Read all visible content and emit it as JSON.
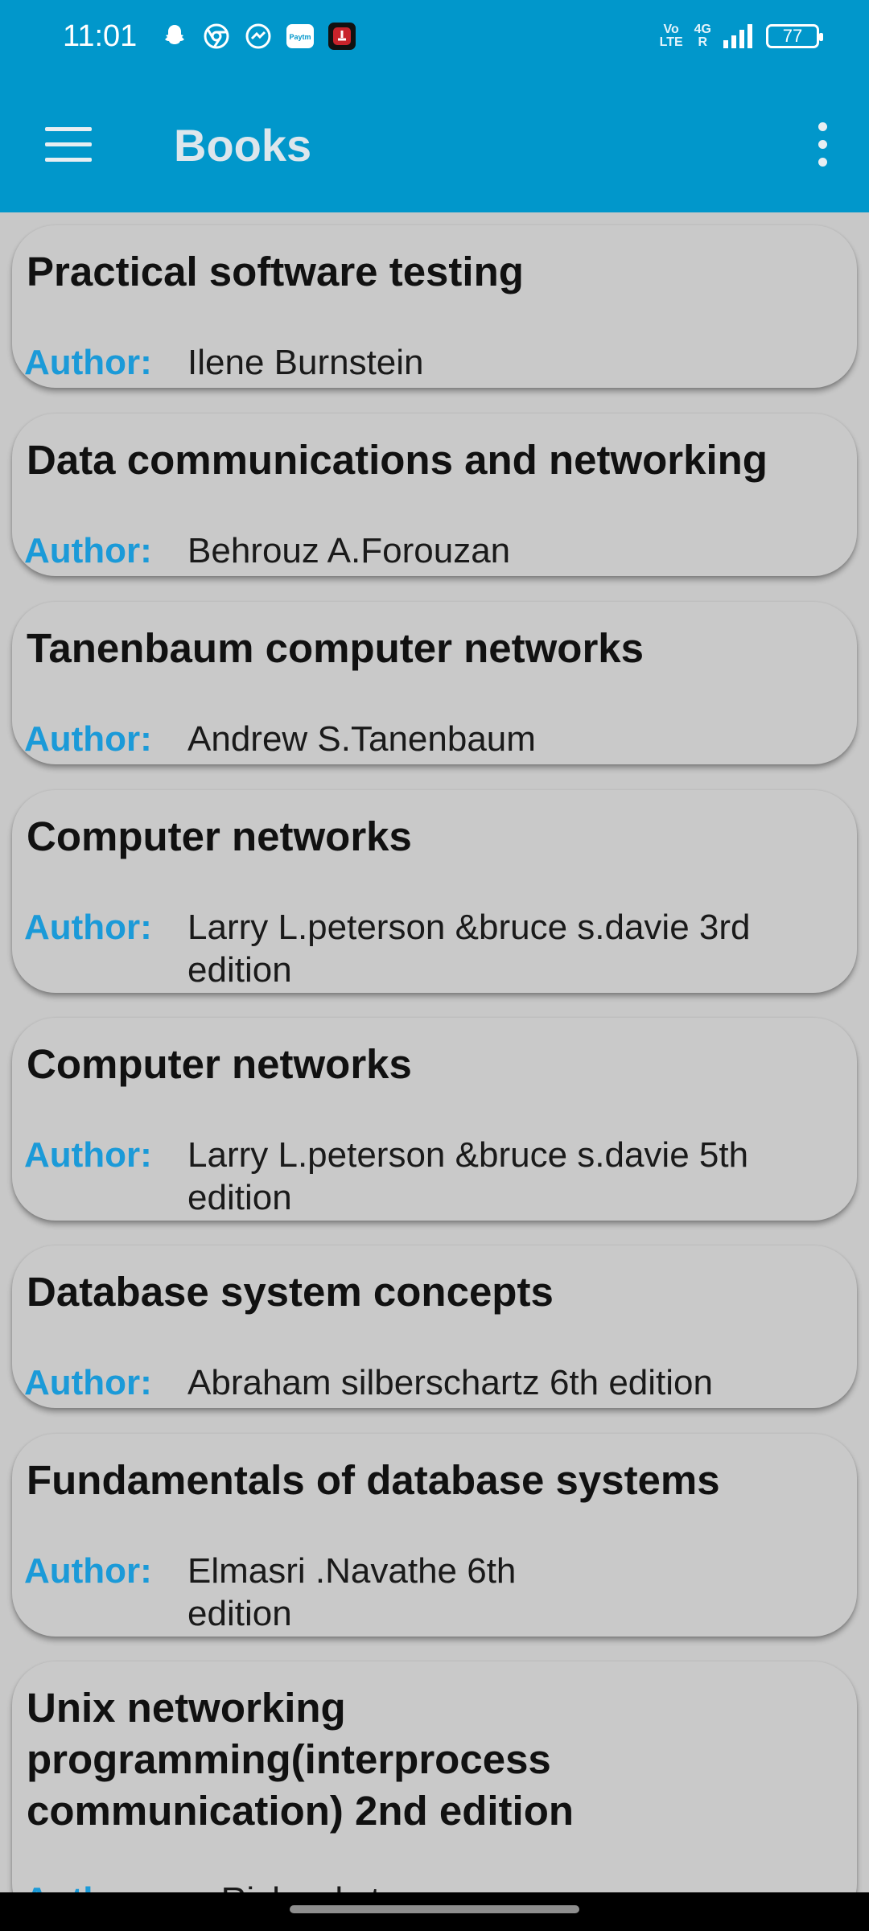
{
  "status_bar": {
    "time": "11:01",
    "notification_icons": [
      "snapchat-icon",
      "chrome-icon",
      "messenger-icon",
      "paytm-icon",
      "app-red-icon"
    ],
    "paytm_text": "Paytm",
    "volte": [
      "Vo",
      "LTE"
    ],
    "network": [
      "4G",
      "R"
    ],
    "battery": "77"
  },
  "app_bar": {
    "title": "Books",
    "menu_icon": "hamburger-menu-icon",
    "overflow_icon": "more-vertical-icon",
    "background_color": "#0197cb"
  },
  "author_label": "Author:",
  "books": [
    {
      "title": "Practical software testing",
      "author": "Ilene Burnstein"
    },
    {
      "title": "Data communications and networking",
      "author": "Behrouz A.Forouzan"
    },
    {
      "title": "Tanenbaum computer networks",
      "author": "Andrew S.Tanenbaum"
    },
    {
      "title": "Computer networks",
      "author": "Larry L.peterson &bruce s.davie 3rd edition"
    },
    {
      "title": "Computer networks",
      "author": "Larry L.peterson &bruce s.davie 5th edition"
    },
    {
      "title": "Database system concepts",
      "author": "Abraham silberschartz 6th edition"
    },
    {
      "title": "Fundamentals of database systems",
      "author": "Elmasri .Navathe 6th edition"
    },
    {
      "title": "Unix networking programming(interprocess communication) 2nd edition",
      "author": "w.Richard stevens"
    }
  ],
  "colors": {
    "accent": "#1b9ad8",
    "card_background": "#c9c9c9",
    "page_background": "#c8c8c8"
  }
}
